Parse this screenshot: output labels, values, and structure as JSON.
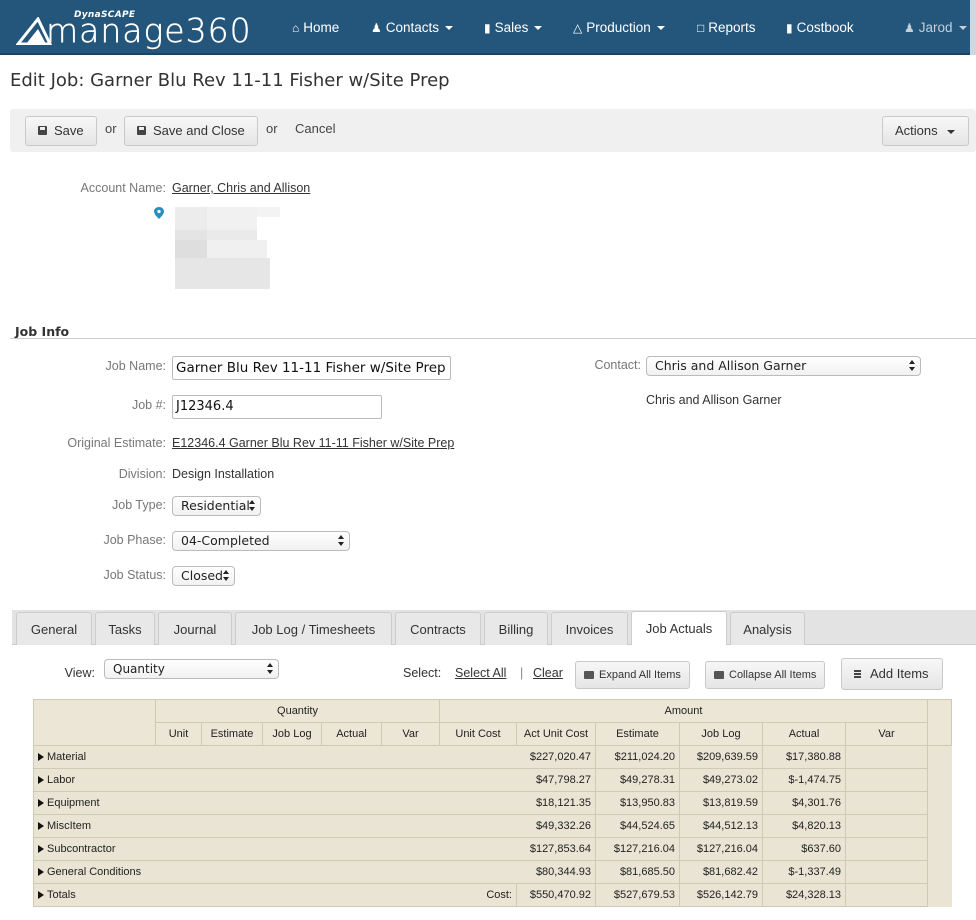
{
  "nav": {
    "brand_small": "DynaSCAPE",
    "brand_word": "manage360",
    "items": [
      {
        "label": "Home",
        "icon": "home-icon",
        "dropdown": false
      },
      {
        "label": "Contacts",
        "icon": "users-icon",
        "dropdown": true
      },
      {
        "label": "Sales",
        "icon": "book-icon",
        "dropdown": true
      },
      {
        "label": "Production",
        "icon": "road-icon",
        "dropdown": true
      },
      {
        "label": "Reports",
        "icon": "file-icon",
        "dropdown": false
      },
      {
        "label": "Costbook",
        "icon": "book-icon",
        "dropdown": false
      }
    ],
    "user": "Jarod",
    "brand_color": "#24567c"
  },
  "page": {
    "title": "Edit Job: Garner Blu Rev 11-11 Fisher w/Site Prep"
  },
  "toolbar": {
    "save": "Save",
    "or1": "or",
    "save_close": "Save and Close",
    "or2": "or",
    "cancel": "Cancel",
    "actions": "Actions"
  },
  "account": {
    "label": "Account Name:",
    "value": "Garner, Chris and Allison"
  },
  "job_info": {
    "section_title": "Job Info",
    "job_name_label": "Job Name:",
    "job_name": "Garner Blu Rev 11-11 Fisher w/Site Prep",
    "job_no_label": "Job #:",
    "job_no": "J12346.4",
    "orig_est_label": "Original Estimate:",
    "orig_est": "E12346.4 Garner Blu Rev 11-11 Fisher w/Site Prep",
    "division_label": "Division:",
    "division": "Design Installation",
    "job_type_label": "Job Type:",
    "job_type": "Residential",
    "job_phase_label": "Job Phase:",
    "job_phase": "04-Completed",
    "job_status_label": "Job Status:",
    "job_status": "Closed",
    "contact_label": "Contact:",
    "contact": "Chris and Allison Garner",
    "contact_display": "Chris and Allison Garner"
  },
  "tabs": [
    {
      "label": "General",
      "active": false
    },
    {
      "label": "Tasks",
      "active": false
    },
    {
      "label": "Journal",
      "active": false
    },
    {
      "label": "Job Log / Timesheets",
      "active": false
    },
    {
      "label": "Contracts",
      "active": false
    },
    {
      "label": "Billing",
      "active": false
    },
    {
      "label": "Invoices",
      "active": false
    },
    {
      "label": "Job Actuals",
      "active": true
    },
    {
      "label": "Analysis",
      "active": false
    }
  ],
  "actuals": {
    "view_label": "View:",
    "view_value": "Quantity",
    "select_label": "Select:",
    "select_all": "Select All",
    "separator": "|",
    "clear": "Clear",
    "expand": "Expand All Items",
    "collapse": "Collapse All Items",
    "add_items": "Add Items",
    "group_quantity": "Quantity",
    "group_amount": "Amount",
    "columns": [
      "Unit",
      "Estimate",
      "Job Log",
      "Actual",
      "Var",
      "Unit Cost",
      "Act Unit Cost",
      "Estimate",
      "Job Log",
      "Actual",
      "Var"
    ],
    "rows": [
      {
        "name": "Material",
        "estimate": "$227,020.47",
        "job_log": "$211,024.20",
        "actual": "$209,639.59",
        "var": "$17,380.88"
      },
      {
        "name": "Labor",
        "estimate": "$47,798.27",
        "job_log": "$49,278.31",
        "actual": "$49,273.02",
        "var": "$-1,474.75"
      },
      {
        "name": "Equipment",
        "estimate": "$18,121.35",
        "job_log": "$13,950.83",
        "actual": "$13,819.59",
        "var": "$4,301.76"
      },
      {
        "name": "MiscItem",
        "estimate": "$49,332.26",
        "job_log": "$44,524.65",
        "actual": "$44,512.13",
        "var": "$4,820.13"
      },
      {
        "name": "Subcontractor",
        "estimate": "$127,853.64",
        "job_log": "$127,216.04",
        "actual": "$127,216.04",
        "var": "$637.60"
      },
      {
        "name": "General Conditions",
        "estimate": "$80,344.93",
        "job_log": "$81,685.50",
        "actual": "$81,682.42",
        "var": "$-1,337.49"
      }
    ],
    "totals": {
      "name": "Totals",
      "label": "Cost:",
      "estimate": "$550,470.92",
      "job_log": "$527,679.53",
      "actual": "$526,142.79",
      "var": "$24,328.13"
    }
  }
}
